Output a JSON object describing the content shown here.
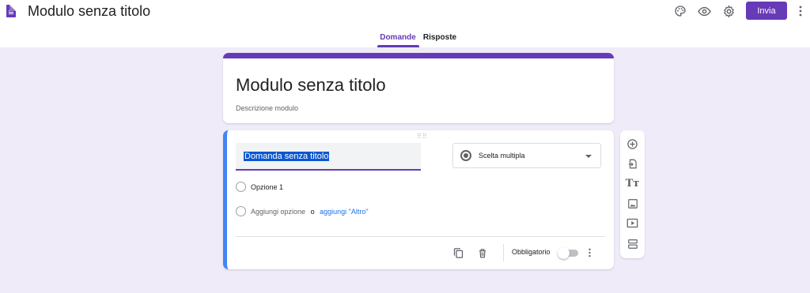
{
  "app": {
    "title": "Modulo senza titolo",
    "send_label": "Invia",
    "accent": "#673ab7"
  },
  "tabs": [
    {
      "label": "Domande",
      "active": true
    },
    {
      "label": "Risposte",
      "active": false
    }
  ],
  "form": {
    "title": "Modulo senza titolo",
    "description": "Descrizione modulo"
  },
  "question": {
    "title": "Domanda senza titolo",
    "type": "Scelta multipla",
    "options": [
      "Opzione 1"
    ],
    "add_option": "Aggiungi opzione",
    "or": "o",
    "add_other": "aggiungi \"Altro\"",
    "required_label": "Obbligatorio",
    "required": false
  },
  "icons": {
    "header": [
      "forms-doc-icon",
      "palette-icon",
      "eye-icon",
      "gear-icon",
      "more-vert-icon"
    ],
    "sidebar": [
      "add-question-icon",
      "import-questions-icon",
      "add-title-icon",
      "add-image-icon",
      "add-video-icon",
      "add-section-icon"
    ],
    "question_footer": [
      "duplicate-icon",
      "delete-icon",
      "more-vert-icon"
    ]
  }
}
